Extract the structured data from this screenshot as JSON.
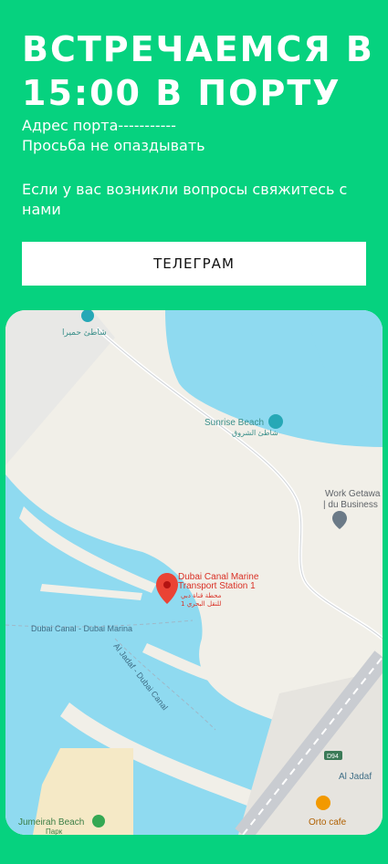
{
  "header": {
    "title": "ВСТРЕЧАЕМСЯ В 15:00 В ПОРТУ",
    "address": "Адрес порта-----------",
    "note": "Просьба не опаздывать",
    "question": "Если у вас возникли вопросы свяжитесь с нами"
  },
  "cta": {
    "label": "ТЕЛЕГРАМ"
  },
  "map": {
    "pin_label_1": "Dubai Canal Marine",
    "pin_label_2": "Transport Station 1",
    "pin_label_ar_1": "محطة قناة دبي",
    "pin_label_ar_2": "للنقل البحري 1",
    "sunrise_beach": "Sunrise Beach",
    "sunrise_beach_ar": "شاطئ الشروق",
    "top_poi_ar": "شاطئ حميرا",
    "work_getaway_1": "Work Getawa",
    "work_getaway_2": "| du Business",
    "canal_label_1": "Dubai Canal - Dubai Marina",
    "canal_label_2": "Al Jadaf - Dubai Canal",
    "road_badge": "D94",
    "al_jadaf": "Al Jadaf",
    "orto_cafe": "Orto cafe",
    "jumeirah_beach": "Jumeirah Beach",
    "park": "Парк",
    "colors": {
      "water": "#8fdaf0",
      "land": "#f1efe8",
      "sand": "#f5e9c6",
      "pin": "#ea4335"
    }
  }
}
